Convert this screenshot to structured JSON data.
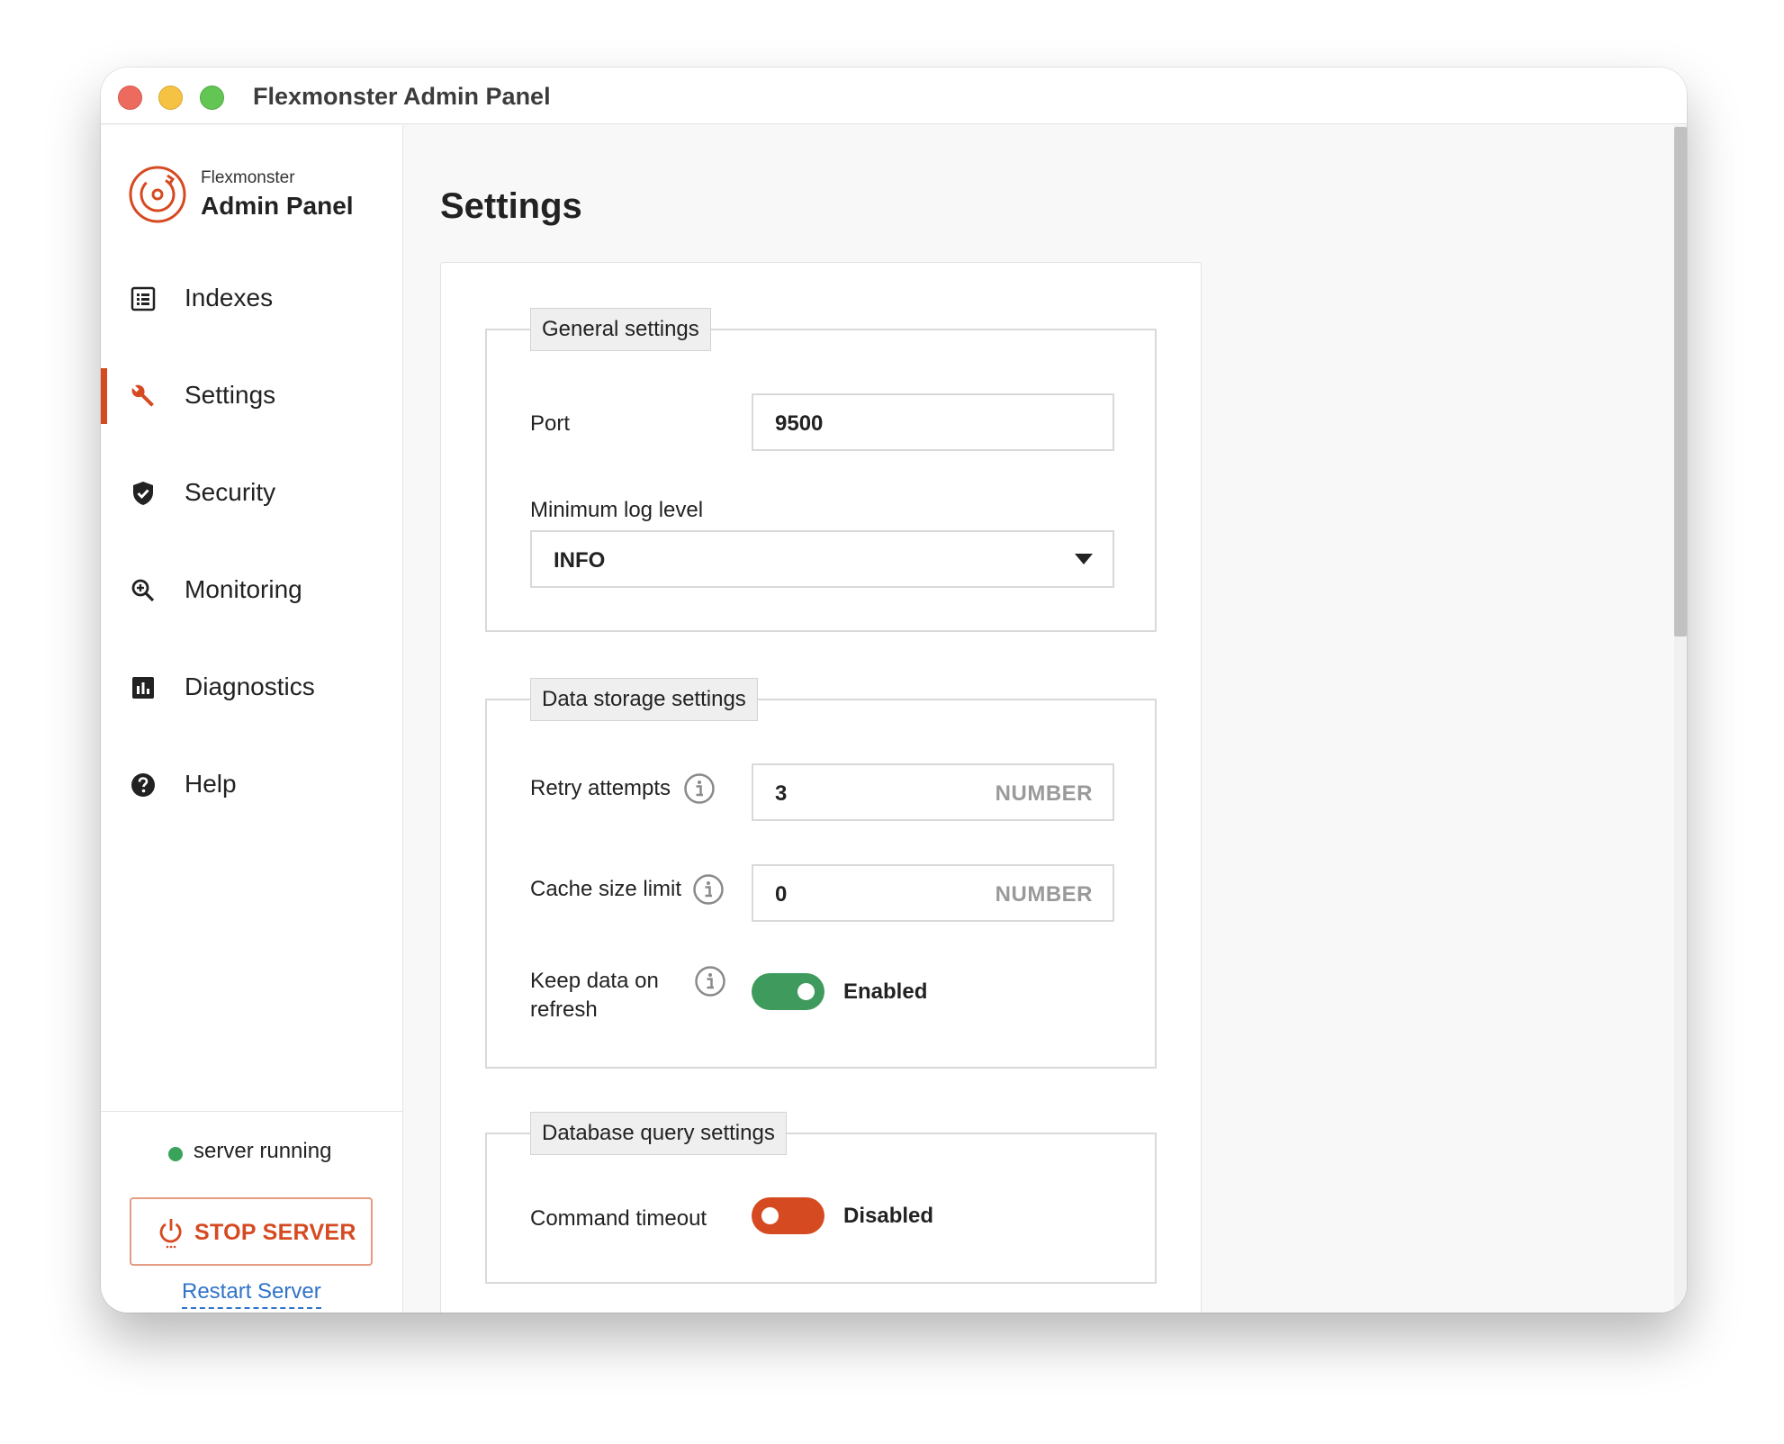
{
  "window": {
    "title": "Flexmonster Admin Panel"
  },
  "brand": {
    "line1": "Flexmonster",
    "line2": "Admin Panel",
    "color": "#d64a22"
  },
  "sidebar": {
    "items": [
      {
        "label": "Indexes",
        "icon": "list-icon",
        "active": false
      },
      {
        "label": "Settings",
        "icon": "wrench-icon",
        "active": true
      },
      {
        "label": "Security",
        "icon": "shield-check-icon",
        "active": false
      },
      {
        "label": "Monitoring",
        "icon": "zoom-in-icon",
        "active": false
      },
      {
        "label": "Diagnostics",
        "icon": "bar-chart-icon",
        "active": false
      },
      {
        "label": "Help",
        "icon": "help-circle-icon",
        "active": false
      }
    ],
    "status": {
      "text": "server running",
      "color": "#3aa35a"
    },
    "stop_button": {
      "label": "STOP SERVER",
      "icon": "power-icon"
    },
    "restart_link": "Restart Server"
  },
  "main": {
    "title": "Settings",
    "general": {
      "legend": "General settings",
      "port": {
        "label": "Port",
        "value": "9500"
      },
      "log_level": {
        "label": "Minimum log level",
        "value": "INFO"
      }
    },
    "storage": {
      "legend": "Data storage settings",
      "retry": {
        "label": "Retry attempts",
        "value": "3",
        "suffix": "NUMBER"
      },
      "cache": {
        "label": "Cache size limit",
        "value": "0",
        "suffix": "NUMBER"
      },
      "keep": {
        "label_line1": "Keep data on",
        "label_line2": "refresh",
        "state": "Enabled",
        "on": true
      }
    },
    "query": {
      "legend": "Database query settings",
      "timeout": {
        "label": "Command timeout",
        "state": "Disabled",
        "on": false
      }
    }
  },
  "colors": {
    "accent": "#d64a22",
    "toggle_on": "#3f9a5d",
    "toggle_off": "#d64a22",
    "link": "#2f73c9"
  }
}
